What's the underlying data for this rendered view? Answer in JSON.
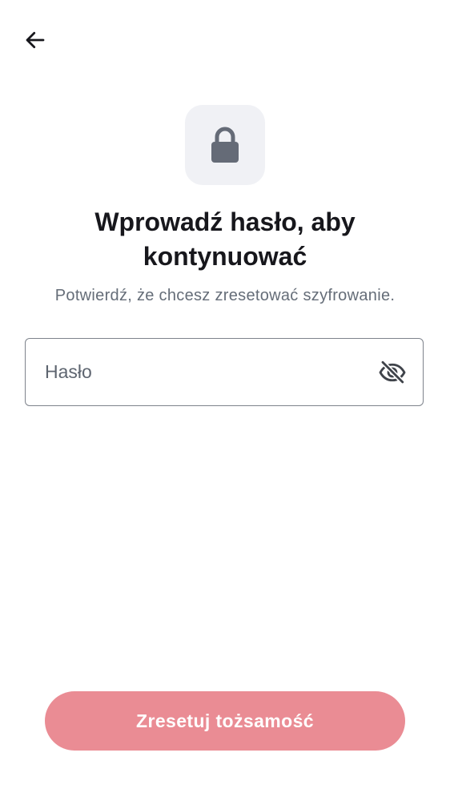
{
  "header": {
    "back_icon": "arrow-left-icon"
  },
  "lock": {
    "icon": "lock-icon",
    "tile_color": "#f0f1f5",
    "icon_color": "#656b77"
  },
  "title": "Wprowadź hasło, aby kontynuować",
  "subtitle": "Potwierdź, że chcesz zresetować szyfrowanie.",
  "password": {
    "placeholder": "Hasło",
    "value": "",
    "toggle_icon": "eye-off-icon"
  },
  "reset_button": {
    "label": "Zresetuj tożsamość",
    "color": "#ea8c94"
  }
}
